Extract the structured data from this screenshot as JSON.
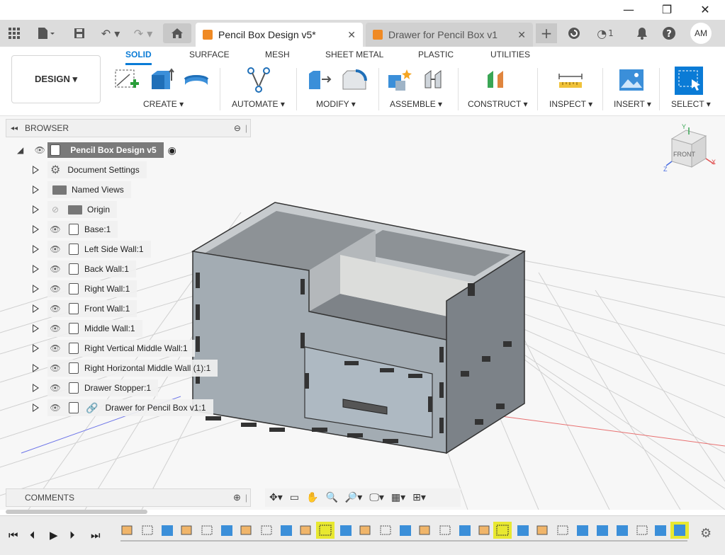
{
  "window": {
    "minimize_label": "—",
    "maximize_label": "❐",
    "close_label": "✕"
  },
  "tabs": [
    {
      "label": "Pencil Box Design v5*",
      "active": true
    },
    {
      "label": "Drawer for Pencil Box v1",
      "active": false
    }
  ],
  "tabbar": {
    "new_tab_label": "+",
    "job_count": "1",
    "user_initials": "AM"
  },
  "ribbon": {
    "workspace_label": "DESIGN ▾",
    "tabs": [
      "SOLID",
      "SURFACE",
      "MESH",
      "SHEET METAL",
      "PLASTIC",
      "UTILITIES"
    ],
    "active_tab": "SOLID",
    "groups": [
      "CREATE ▾",
      "AUTOMATE ▾",
      "MODIFY ▾",
      "ASSEMBLE ▾",
      "CONSTRUCT ▾",
      "INSPECT ▾",
      "INSERT ▾",
      "SELECT ▾"
    ]
  },
  "browser": {
    "title": "BROWSER",
    "root": "Pencil Box Design v5",
    "items": [
      {
        "label": "Document Settings"
      },
      {
        "label": "Named Views"
      },
      {
        "label": "Origin"
      },
      {
        "label": "Base:1"
      },
      {
        "label": "Left Side Wall:1"
      },
      {
        "label": "Back Wall:1"
      },
      {
        "label": "Right Wall:1"
      },
      {
        "label": "Front Wall:1"
      },
      {
        "label": "Middle Wall:1"
      },
      {
        "label": "Right Vertical Middle Wall:1"
      },
      {
        "label": "Right Horizontal Middle Wall (1):1"
      },
      {
        "label": "Drawer Stopper:1"
      },
      {
        "label": "Drawer for Pencil Box v1:1"
      }
    ]
  },
  "comments": {
    "title": "COMMENTS"
  },
  "viewcube": {
    "face_label": "FRONT",
    "axes": [
      "Y",
      "X",
      "Z"
    ]
  },
  "colors": {
    "accent": "#0a7bd6",
    "timeline_highlight": "#e8e830",
    "model_gray": "#a3acb3"
  }
}
